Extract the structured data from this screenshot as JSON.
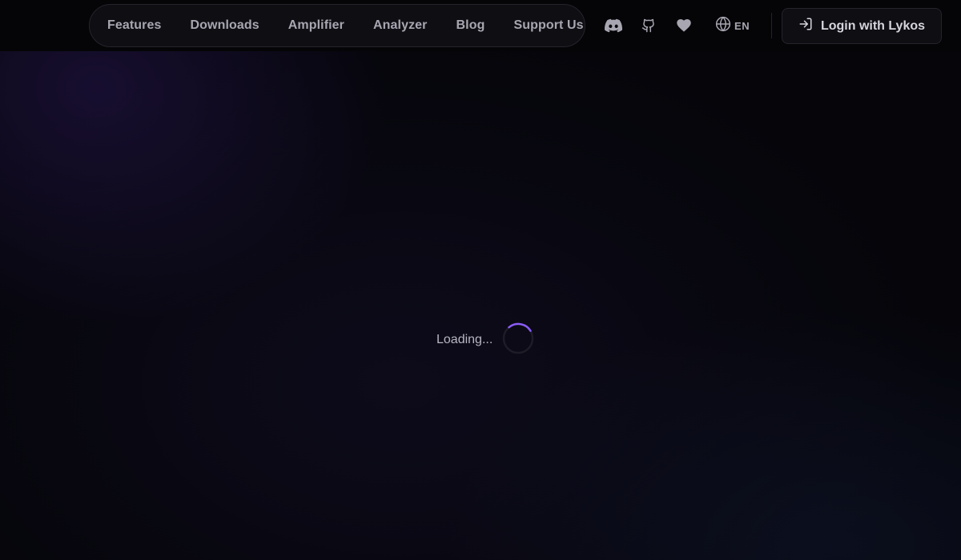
{
  "nav": {
    "links": [
      {
        "label": "Features"
      },
      {
        "label": "Downloads"
      },
      {
        "label": "Amplifier"
      },
      {
        "label": "Analyzer"
      },
      {
        "label": "Blog"
      },
      {
        "label": "Support Us"
      }
    ]
  },
  "header": {
    "icons": [
      "discord-icon",
      "github-icon",
      "heart-icon",
      "globe-icon"
    ],
    "language": "EN",
    "login_label": "Login with Lykos"
  },
  "main": {
    "loading_text": "Loading..."
  },
  "colors": {
    "background": "#05050a",
    "surface": "#0e0e13",
    "border": "#25242c",
    "text_muted": "#a7a6b1",
    "accent": "#8b5cf6"
  }
}
